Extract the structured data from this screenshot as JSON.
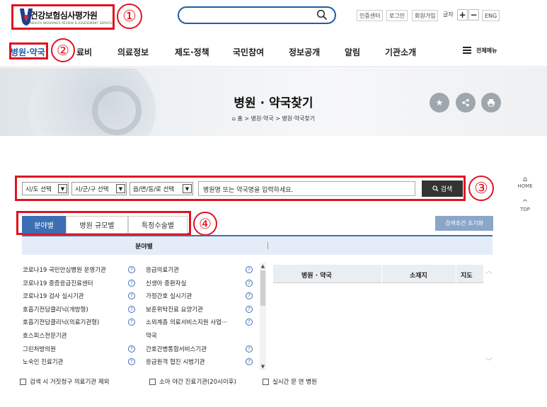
{
  "header": {
    "logo_ko": "건강보험심사평가원",
    "logo_en": "HEALTH INSURANCE REVIEW & ASSESSMENT SERVICE",
    "search_placeholder": "",
    "util_links": [
      "인증센터",
      "로그인",
      "회원가입"
    ],
    "font_size_label": "글자",
    "font_plus": "+",
    "font_minus": "−",
    "lang": "ENG"
  },
  "annotations": [
    "①",
    "②",
    "③",
    "④"
  ],
  "nav": {
    "items": [
      "병원·약국",
      "진료비",
      "의료정보",
      "제도·정책",
      "국민참여",
      "정보공개",
      "알림",
      "기관소개"
    ],
    "visible_partial": "료비",
    "all_menu": "전체메뉴"
  },
  "hero": {
    "title": "병원 · 약국찾기",
    "breadcrumb": [
      "홈",
      "병원·약국",
      "병원·약국찾기"
    ],
    "breadcrumb_sep": ">"
  },
  "filters": {
    "sido": "시/도 선택",
    "sigungu": "시/군/구 선택",
    "dong": "읍/면/동/로 선택",
    "search_placeholder": "병원명 또는 약국명을 입력하세요.",
    "search_button": "검색"
  },
  "tabs": [
    "분야별",
    "병원 규모별",
    "특정수술별"
  ],
  "reset_button": "검색조건 초기화",
  "panel": {
    "header": "분야별",
    "left_items": [
      "코로나19 국민안심병원 운영기관",
      "코로나19 중증응급진료센터",
      "코로나19 검사 실시기관",
      "호흡기전담클리닉(개방형)",
      "호흡기전담클리닉(의료기관형)",
      "호스피스전문기관",
      "그린처방의원",
      "노숙인 진료기관",
      "의료취약지 응급의료 헬기 사업"
    ],
    "right_items": [
      "응급의료기관",
      "신생아 중환자실",
      "가정간호 실시기관",
      "보훈위탁진료 요양기관",
      "소외계층 의료서비스지원 사업···",
      "약국",
      "간호간병통합서비스기관",
      "응급원격 협진 시범기관",
      "가정형 호스피스 전문기관"
    ]
  },
  "results": {
    "columns": [
      "병원 · 약국",
      "소재지",
      "지도"
    ]
  },
  "checkboxes": [
    "검색 시 거짓청구 의료기관 제외",
    "소아 야간 진료기관(20시이후)",
    "실시간 문 연 병원"
  ],
  "side": {
    "home": "HOME",
    "top": "TOP"
  }
}
